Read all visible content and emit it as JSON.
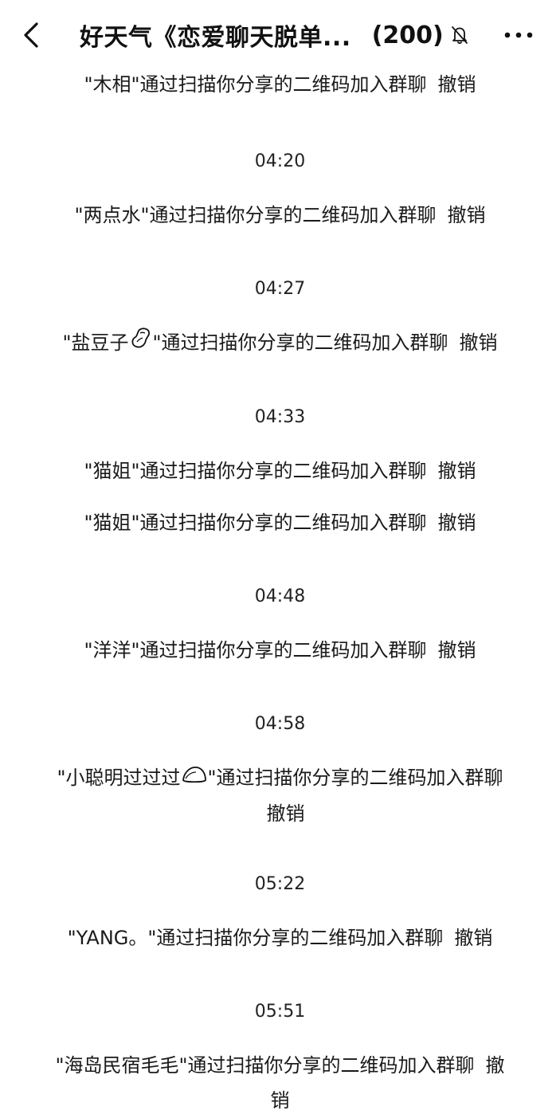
{
  "header": {
    "title": "好天气《恋爱聊天脱单...",
    "member_count": "(200)",
    "icons": {
      "back": "back-chevron-icon",
      "mute": "bell-muted-icon",
      "more": "more-dots-icon"
    }
  },
  "messages": [
    {
      "type": "system",
      "name": "\"木相\"",
      "text": "通过扫描你分享的二维码加入群聊",
      "action": "撤销"
    },
    {
      "type": "time",
      "text": "04:20"
    },
    {
      "type": "system",
      "name": "\"两点水\"",
      "text": "通过扫描你分享的二维码加入群聊",
      "action": "撤销"
    },
    {
      "type": "time",
      "text": "04:27"
    },
    {
      "type": "system",
      "name": "\"盐豆子",
      "emoji": "peanut-emoji",
      "name_end": "\"",
      "text": "通过扫描你分享的二维码加入群聊",
      "action": "撤销"
    },
    {
      "type": "time",
      "text": "04:33"
    },
    {
      "type": "system",
      "name": "\"猫姐\"",
      "text": "通过扫描你分享的二维码加入群聊",
      "action": "撤销"
    },
    {
      "type": "system",
      "name": "\"猫姐\"",
      "text": "通过扫描你分享的二维码加入群聊",
      "action": "撤销"
    },
    {
      "type": "time",
      "text": "04:48"
    },
    {
      "type": "system",
      "name": "\"洋洋\"",
      "text": "通过扫描你分享的二维码加入群聊",
      "action": "撤销"
    },
    {
      "type": "time",
      "text": "04:58"
    },
    {
      "type": "system",
      "name": "\"小聪明过过过",
      "emoji": "rice-ball-emoji",
      "name_end": "\"",
      "text": "通过扫描你分享的二维码加入群聊",
      "action": "撤销"
    },
    {
      "type": "time",
      "text": "05:22"
    },
    {
      "type": "system",
      "name": "\"YANG。\"",
      "text": "通过扫描你分享的二维码加入群聊",
      "action": "撤销"
    },
    {
      "type": "time",
      "text": "05:51"
    },
    {
      "type": "system",
      "name": "\"海岛民宿毛毛\"",
      "text": "通过扫描你分享的二维码加入群聊",
      "action": "撤销"
    }
  ]
}
